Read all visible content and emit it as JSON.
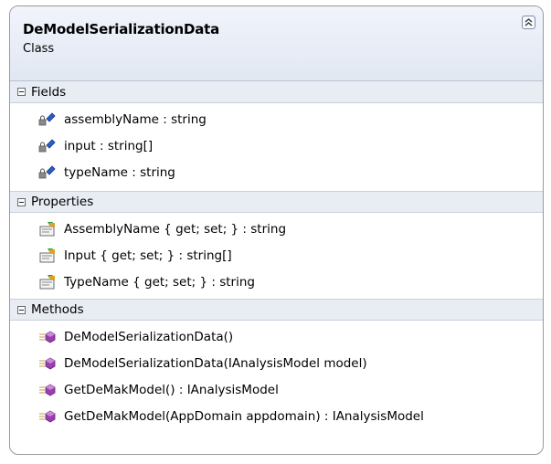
{
  "class_name": "DeModelSerializationData",
  "stereotype": "Class",
  "sections": {
    "fields": {
      "title": "Fields",
      "items": [
        "assemblyName : string",
        "input : string[]",
        "typeName : string"
      ]
    },
    "properties": {
      "title": "Properties",
      "items": [
        "AssemblyName { get; set; } : string",
        "Input { get; set; } : string[]",
        "TypeName { get; set; } : string"
      ]
    },
    "methods": {
      "title": "Methods",
      "items": [
        "DeModelSerializationData()",
        "DeModelSerializationData(IAnalysisModel model)",
        "GetDeMakModel() : IAnalysisModel",
        "GetDeMakModel(AppDomain appdomain) : IAnalysisModel"
      ]
    }
  },
  "icons": {
    "field": "private-field-icon",
    "property": "property-icon",
    "method": "public-method-icon",
    "collapse": "chevron-double-up-icon",
    "section_toggle": "minus-box-icon"
  },
  "colors": {
    "header_top": "#f1f4fb",
    "header_bottom": "#e1e7f2",
    "border": "#9a9a9a",
    "method_icon": "#9b3fb0",
    "field_icon": "#2a5fc8"
  }
}
